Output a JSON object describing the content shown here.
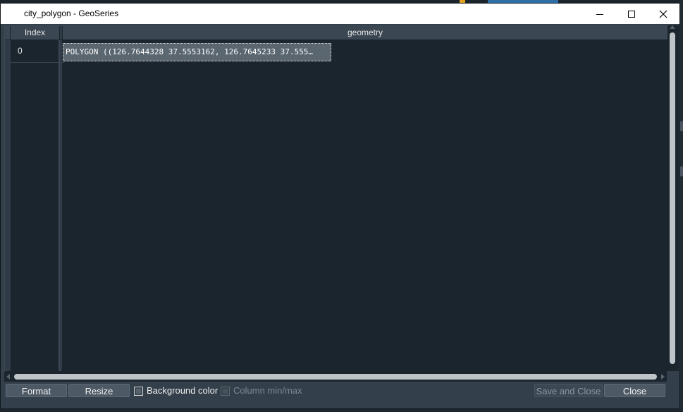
{
  "window": {
    "title": "city_polygon - GeoSeries",
    "minimize_icon": "minimize-icon",
    "maximize_icon": "maximize-icon",
    "close_icon": "close-icon"
  },
  "table": {
    "columns": [
      "Index",
      "geometry"
    ],
    "rows": [
      {
        "index": "0",
        "geometry": "POLYGON ((126.7644328 37.5553162, 126.7645233 37.555…"
      }
    ]
  },
  "controls": {
    "format_label": "Format",
    "resize_label": "Resize",
    "background_color_label": "Background color",
    "column_minmax_label": "Column min/max",
    "save_and_close_label": "Save and Close",
    "close_label": "Close"
  },
  "state": {
    "background_color_checked": false,
    "column_minmax_enabled": false,
    "save_and_close_enabled": false
  },
  "colors": {
    "dialog_bg": "#333f4a",
    "table_bg": "#1b252e",
    "selected_cell": "#5a6670",
    "button_bg": "#4d5a66"
  }
}
